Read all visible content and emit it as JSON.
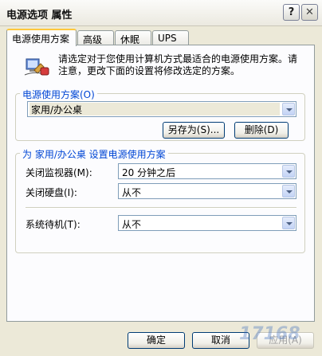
{
  "window": {
    "title": "电源选项 属性",
    "help_label": "?",
    "close_label": "✕"
  },
  "tabs": [
    "电源使用方案",
    "高级",
    "休眠",
    "UPS"
  ],
  "intro": {
    "icon": "power-plan-icon",
    "text": "请选定对于您使用计算机方式最适合的电源使用方案。请注意，更改下面的设置将修改选定的方案。"
  },
  "scheme_group": {
    "label": "电源使用方案(O)",
    "selected": "家用/办公桌",
    "save_as_label": "另存为(S)...",
    "delete_label": "删除(D)"
  },
  "settings_group": {
    "label": "为 家用/办公桌 设置电源使用方案",
    "monitor_label": "关闭监视器(M):",
    "monitor_value": "20 分钟之后",
    "harddisk_label": "关闭硬盘(I):",
    "harddisk_value": "从不",
    "standby_label": "系统待机(T):",
    "standby_value": "从不"
  },
  "footer": {
    "ok_label": "确定",
    "cancel_label": "取消",
    "apply_label": "应用(A)"
  },
  "watermark": "17168",
  "colors": {
    "dialog_bg": "#ece9d8",
    "group_label": "#0046d5",
    "tab_highlight": "#ffc83c"
  }
}
